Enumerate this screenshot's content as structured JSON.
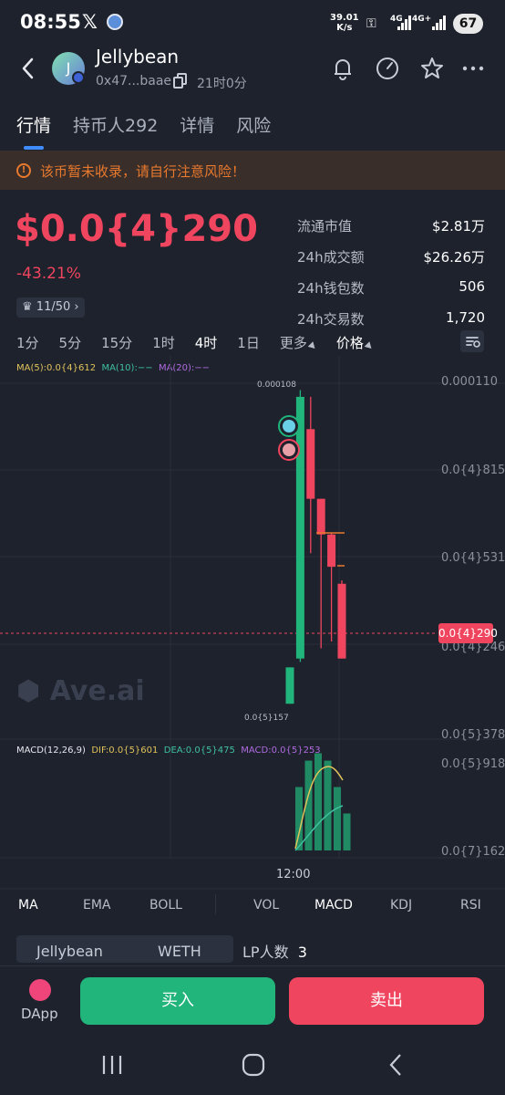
{
  "status_bar": {
    "time": "08:55",
    "x_label": "𝕏",
    "speed_value": "39.01",
    "speed_unit": "K/s",
    "net1": "4G",
    "net2": "4G+",
    "battery": "67"
  },
  "header": {
    "avatar_letter": "J",
    "token_name": "Jellybean",
    "address": "0x47...baae",
    "age": "21时0分"
  },
  "tabs": [
    {
      "label": "行情",
      "active": true
    },
    {
      "label": "持币人292",
      "active": false
    },
    {
      "label": "详情",
      "active": false
    },
    {
      "label": "风险",
      "active": false
    }
  ],
  "warning": {
    "icon": "!",
    "text": "该币暂未收录，请自行注意风险！"
  },
  "price": {
    "value": "$0.0{4}290",
    "change": "-43.21%",
    "rank": "11/50"
  },
  "stats": [
    {
      "label": "流通市值",
      "value": "$2.81万"
    },
    {
      "label": "24h成交额",
      "value": "$26.26万"
    },
    {
      "label": "24h钱包数",
      "value": "506"
    },
    {
      "label": "24h交易数",
      "value": "1,720"
    }
  ],
  "timeframes": [
    {
      "label": "1分",
      "selected": false
    },
    {
      "label": "5分",
      "selected": false
    },
    {
      "label": "15分",
      "selected": false
    },
    {
      "label": "1时",
      "selected": false
    },
    {
      "label": "4时",
      "selected": true
    },
    {
      "label": "1日",
      "selected": false
    },
    {
      "label": "更多",
      "selected": false,
      "dropdown": true
    },
    {
      "label": "价格",
      "selected": false,
      "dropdown": true
    }
  ],
  "ma_legend": {
    "ma5": "MA(5):0.0{4}612",
    "ma10": "MA(10):−−",
    "ma20": "MA(20):−−"
  },
  "macd_legend": {
    "label": "MACD(12,26,9)",
    "dif": "DIF:0.0{5}601",
    "dea": "DEA:0.0{5}475",
    "macd": "MACD:0.0{5}253"
  },
  "price_axis": [
    "0.000110",
    "0.0{4}815",
    "0.0{4}531",
    "0.0{4}246",
    "0.0{5}378"
  ],
  "current_price_tag": "0.0{4}290",
  "high_label": "0.000108",
  "low_label": "0.0{5}157",
  "macd_axis": [
    "0.0{5}918",
    "0.0{7}162"
  ],
  "time_axis": "12:00",
  "watermark": "Ave.ai",
  "chart_data": {
    "type": "candlestick",
    "candles": [
      {
        "open": 1.57e-05,
        "close": 2.64e-05,
        "high": 2.64e-05,
        "low": 1.57e-05,
        "dir": "up"
      },
      {
        "open": 2.9e-05,
        "close": 0.000106,
        "high": 0.000108,
        "low": 2.8e-05,
        "dir": "up"
      },
      {
        "open": 9.65e-05,
        "close": 7.6e-05,
        "high": 0.000106,
        "low": 6e-05,
        "dir": "down"
      },
      {
        "open": 7.6e-05,
        "close": 6.55e-05,
        "high": 7.6e-05,
        "low": 3.2e-05,
        "dir": "down"
      },
      {
        "open": 6.55e-05,
        "close": 5.6e-05,
        "high": 6.6e-05,
        "low": 3.4e-05,
        "dir": "down"
      },
      {
        "open": 5.1e-05,
        "close": 2.9e-05,
        "high": 5.2e-05,
        "low": 2.9e-05,
        "dir": "down"
      }
    ],
    "macd_hist": [
      6e-06,
      8.5e-06,
      9.2e-06,
      8.5e-06,
      6e-06,
      3.5e-06
    ],
    "ma5_color": "#e0c35a",
    "dif_color": "#e0c35a",
    "dea_color": "#3fc0a0",
    "up_color": "#21b47b",
    "down_color": "#f0455e"
  },
  "indicators": [
    {
      "label": "MA",
      "selected": true
    },
    {
      "label": "EMA",
      "selected": false
    },
    {
      "label": "BOLL",
      "selected": false
    },
    {
      "label": "VOL",
      "selected": false
    },
    {
      "label": "MACD",
      "selected": true
    },
    {
      "label": "KDJ",
      "selected": false
    },
    {
      "label": "RSI",
      "selected": false
    }
  ],
  "pool": {
    "token_a": "Jellybean",
    "token_b": "WETH",
    "lp_label": "LP人数",
    "lp_value": "3"
  },
  "bottom": {
    "dapp_label": "DApp",
    "buy_label": "买入",
    "sell_label": "卖出"
  },
  "colors": {
    "red": "#f0455e",
    "green": "#21b47b",
    "accent": "#3f8cff",
    "warn": "#e8792d"
  }
}
